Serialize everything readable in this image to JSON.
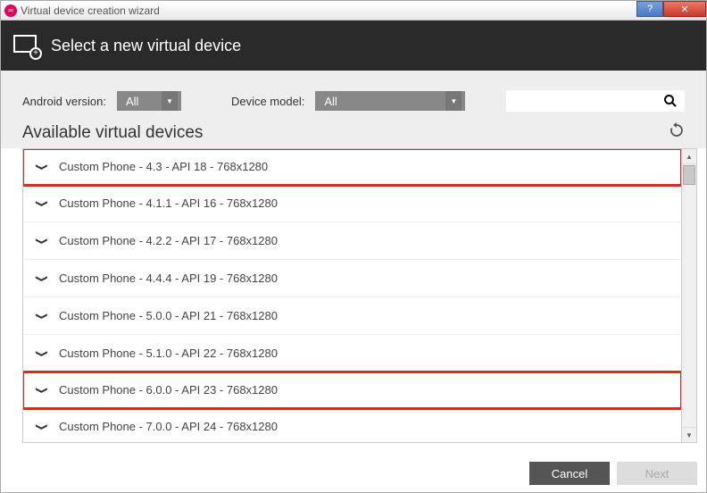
{
  "window": {
    "title": "Virtual device creation wizard"
  },
  "header": {
    "title": "Select a new virtual device"
  },
  "filters": {
    "android_label": "Android version:",
    "android_value": "All",
    "model_label": "Device model:",
    "model_value": "All",
    "search_placeholder": ""
  },
  "section": {
    "title": "Available virtual devices"
  },
  "devices": [
    {
      "label": "Custom Phone - 4.3 - API 18 - 768x1280",
      "highlight": true
    },
    {
      "label": "Custom Phone - 4.1.1 - API 16 - 768x1280",
      "highlight": false
    },
    {
      "label": "Custom Phone - 4.2.2 - API 17 - 768x1280",
      "highlight": false
    },
    {
      "label": "Custom Phone - 4.4.4 - API 19 - 768x1280",
      "highlight": false
    },
    {
      "label": "Custom Phone - 5.0.0 - API 21 - 768x1280",
      "highlight": false
    },
    {
      "label": "Custom Phone - 5.1.0 - API 22 - 768x1280",
      "highlight": false
    },
    {
      "label": "Custom Phone - 6.0.0 - API 23 - 768x1280",
      "highlight": true
    },
    {
      "label": "Custom Phone - 7.0.0 - API 24 - 768x1280",
      "highlight": false
    }
  ],
  "footer": {
    "cancel": "Cancel",
    "next": "Next"
  }
}
